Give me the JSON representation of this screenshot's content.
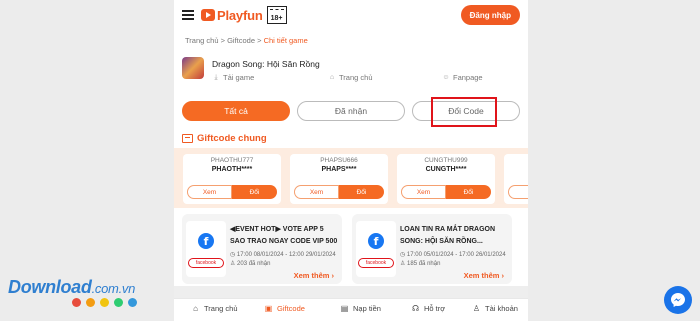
{
  "header": {
    "logo_text": "Playfun",
    "age_rating": "18+",
    "login_label": "Đăng nhập"
  },
  "breadcrumb": {
    "home": "Trang chủ",
    "sep1": " > ",
    "giftcode": "Giftcode",
    "sep2": " > ",
    "current": "Chi tiết game"
  },
  "game": {
    "title": "Dragon Song: Hội Săn Rồng",
    "links": {
      "download": "Tải game",
      "homepage": "Trang chủ",
      "fanpage": "Fanpage"
    }
  },
  "tabs": {
    "all": "Tất cả",
    "received": "Đã nhận",
    "redeem": "Đổi Code"
  },
  "section": {
    "title": "Giftcode chung"
  },
  "codes": [
    {
      "name": "PHAOTHU777",
      "value": "PHAOTH****",
      "view": "Xem",
      "redeem": "Đổi"
    },
    {
      "name": "PHAPSU666",
      "value": "PHAPS****",
      "view": "Xem",
      "redeem": "Đổi"
    },
    {
      "name": "CUNGTHU999",
      "value": "CUNGTH****",
      "view": "Xem",
      "redeem": "Đổi"
    }
  ],
  "news": [
    {
      "tag": "facebook",
      "title": "◀EVENT HOT▶ VOTE APP 5 SAO TRAO NGAY CODE VIP 500",
      "date": "17:00 08/01/2024 - 12:00 29/01/2024",
      "count": "203 đã nhận",
      "more": "Xem thêm ›"
    },
    {
      "tag": "facebook",
      "title": "LOAN TIN RA MẮT DRAGON SONG: HỘI SĂN RỒNG...",
      "date": "17:00 05/01/2024 - 17:00 26/01/2024",
      "count": "185 đã nhận",
      "more": "Xem thêm ›"
    }
  ],
  "bottom_nav": {
    "home": "Trang chủ",
    "giftcode": "Giftcode",
    "topup": "Nạp tiền",
    "support": "Hỗ trợ",
    "account": "Tài khoản"
  },
  "watermark": {
    "main": "Download",
    "suffix": ".com.vn",
    "dot_colors": [
      "#e74c3c",
      "#f39c12",
      "#f1c40f",
      "#2ecc71",
      "#3498db"
    ]
  },
  "colors": {
    "brand": "#f05a22",
    "highlight": "#e0141a",
    "facebook": "#1877f2"
  }
}
